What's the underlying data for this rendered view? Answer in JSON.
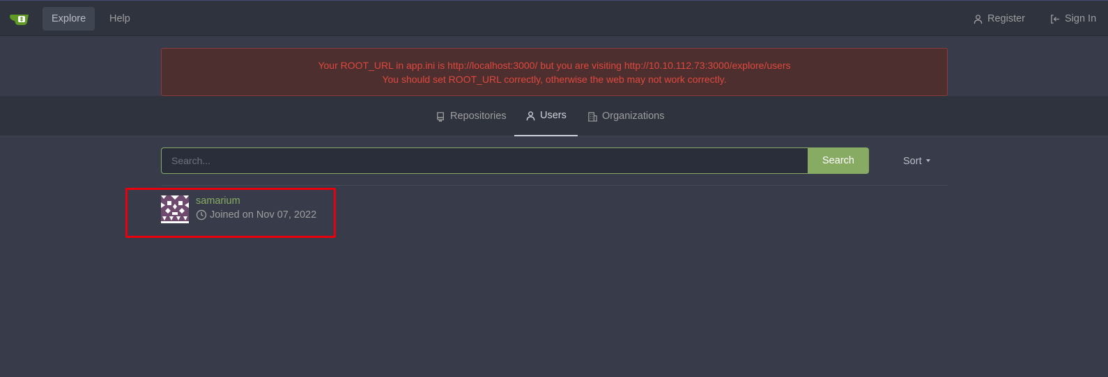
{
  "nav": {
    "explore": "Explore",
    "help": "Help",
    "register": "Register",
    "sign_in": "Sign In"
  },
  "warning": {
    "line1": "Your ROOT_URL in app.ini is http://localhost:3000/ but you are visiting http://10.10.112.73:3000/explore/users",
    "line2": "You should set ROOT_URL correctly, otherwise the web may not work correctly."
  },
  "tabs": [
    {
      "label": "Repositories",
      "active": false
    },
    {
      "label": "Users",
      "active": true
    },
    {
      "label": "Organizations",
      "active": false
    }
  ],
  "search": {
    "placeholder": "Search...",
    "value": "",
    "button": "Search"
  },
  "sort_label": "Sort",
  "users": [
    {
      "name": "samarium",
      "joined": "Joined on Nov 07, 2022"
    }
  ],
  "colors": {
    "accent_green": "#87ab63",
    "warning_red": "#e0483e",
    "highlight_red": "#e8000d"
  }
}
